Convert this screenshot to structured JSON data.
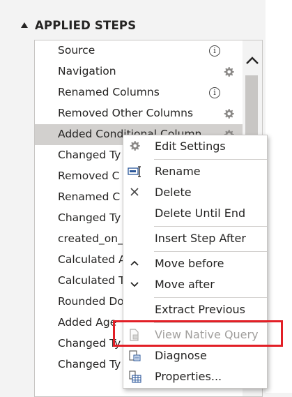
{
  "panel": {
    "title": "APPLIED STEPS"
  },
  "steps": [
    {
      "label": "Source",
      "icon": "info-icon"
    },
    {
      "label": "Navigation",
      "icon": "gear-icon"
    },
    {
      "label": "Renamed Columns",
      "icon": "info-icon"
    },
    {
      "label": "Removed Other Columns",
      "icon": "gear-icon"
    },
    {
      "label": "Added Conditional Column",
      "icon": "gear-icon",
      "selected": true
    },
    {
      "label": "Changed Ty"
    },
    {
      "label": "Removed C"
    },
    {
      "label": "Renamed C"
    },
    {
      "label": "Changed Ty"
    },
    {
      "label": "created_on_"
    },
    {
      "label": "Calculated A"
    },
    {
      "label": "Calculated T"
    },
    {
      "label": "Rounded Do"
    },
    {
      "label": "Added Age"
    },
    {
      "label": "Changed Ty"
    },
    {
      "label": "Changed Ty"
    }
  ],
  "context_menu": {
    "items": [
      {
        "label": "Edit Settings",
        "icon": "gear-icon",
        "enabled": true
      },
      {
        "label": "Rename",
        "icon": "rename-icon",
        "enabled": true
      },
      {
        "label": "Delete",
        "icon": "delete-x-icon",
        "enabled": true
      },
      {
        "label": "Delete Until End",
        "icon": "",
        "enabled": true
      },
      {
        "label": "Insert Step After",
        "icon": "",
        "enabled": true
      },
      {
        "label": "Move before",
        "icon": "chevron-up-icon",
        "enabled": true
      },
      {
        "label": "Move after",
        "icon": "chevron-down-icon",
        "enabled": true
      },
      {
        "label": "Extract Previous",
        "icon": "",
        "enabled": true
      },
      {
        "label": "View Native Query",
        "icon": "native-query-icon",
        "enabled": false
      },
      {
        "label": "Diagnose",
        "icon": "diagnose-icon",
        "enabled": true
      },
      {
        "label": "Properties...",
        "icon": "properties-icon",
        "enabled": true
      }
    ]
  },
  "colors": {
    "highlight_box": "#e21f26",
    "selected_row": "#d2d0ce",
    "disabled_text": "#a19f9d"
  }
}
